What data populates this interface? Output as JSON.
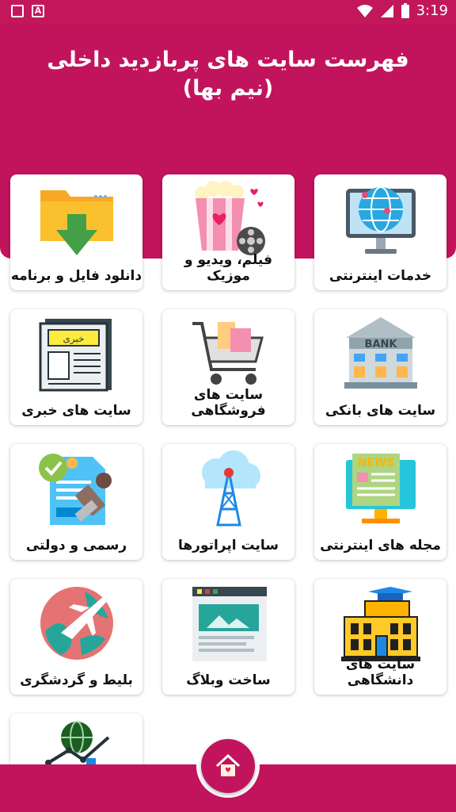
{
  "status_bar": {
    "time": "3:19"
  },
  "header": {
    "title_line1": "فهرست سایت های پربازدید داخلی",
    "title_line2": "(نیم بها)"
  },
  "cards": [
    {
      "label": "خدمات اینترنتی",
      "icon": "globe-monitor-icon"
    },
    {
      "label": "فیلم، ویدیو و موزیک",
      "icon": "popcorn-film-icon"
    },
    {
      "label": "دانلود فایل و برنامه",
      "icon": "folder-download-icon"
    },
    {
      "label": "سایت های بانکی",
      "icon": "bank-icon"
    },
    {
      "label": "سایت های فروشگاهی",
      "icon": "shopping-cart-icon"
    },
    {
      "label": "سایت های خبری",
      "icon": "newspaper-icon"
    },
    {
      "label": "مجله های اینترنتی",
      "icon": "news-monitor-icon"
    },
    {
      "label": "سایت اپراتورها",
      "icon": "antenna-tower-icon"
    },
    {
      "label": "رسمی و دولتی",
      "icon": "stamp-document-icon"
    },
    {
      "label": "سایت های دانشگاهی",
      "icon": "university-icon"
    },
    {
      "label": "ساخت وبلاگ",
      "icon": "webpage-icon"
    },
    {
      "label": "بلیط و گردشگری",
      "icon": "airplane-globe-icon"
    },
    {
      "label": "",
      "icon": "globe-chart-icon"
    }
  ],
  "image_texts": {
    "newspaper": "خبری",
    "bank": "BANK",
    "news": "NEWS"
  },
  "colors": {
    "primary": "#c2145d"
  }
}
